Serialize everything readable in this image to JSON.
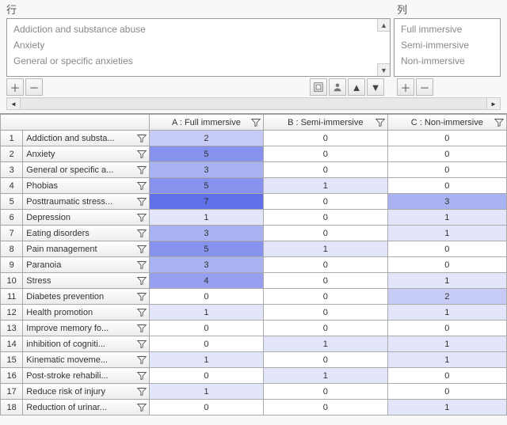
{
  "labels": {
    "rows_header": "行",
    "cols_header": "列"
  },
  "row_listbox": [
    "Addiction and substance abuse",
    "Anxiety",
    "General or specific anxieties"
  ],
  "col_listbox": [
    "Full immersive",
    "Semi-immersive",
    "Non-immersive"
  ],
  "columns": [
    {
      "key": "A",
      "label": "A : Full immersive"
    },
    {
      "key": "B",
      "label": "B : Semi-immersive"
    },
    {
      "key": "C",
      "label": "C : Non-immersive"
    }
  ],
  "rows": [
    {
      "n": 1,
      "label": "Addiction and substa...",
      "A": 2,
      "B": 0,
      "C": 0
    },
    {
      "n": 2,
      "label": "Anxiety",
      "A": 5,
      "B": 0,
      "C": 0
    },
    {
      "n": 3,
      "label": "General or specific a...",
      "A": 3,
      "B": 0,
      "C": 0
    },
    {
      "n": 4,
      "label": "Phobias",
      "A": 5,
      "B": 1,
      "C": 0
    },
    {
      "n": 5,
      "label": "Posttraumatic stress...",
      "A": 7,
      "B": 0,
      "C": 3
    },
    {
      "n": 6,
      "label": "Depression",
      "A": 1,
      "B": 0,
      "C": 1
    },
    {
      "n": 7,
      "label": "Eating disorders",
      "A": 3,
      "B": 0,
      "C": 1
    },
    {
      "n": 8,
      "label": "Pain management",
      "A": 5,
      "B": 1,
      "C": 0
    },
    {
      "n": 9,
      "label": "Paranoia",
      "A": 3,
      "B": 0,
      "C": 0
    },
    {
      "n": 10,
      "label": "Stress",
      "A": 4,
      "B": 0,
      "C": 1
    },
    {
      "n": 11,
      "label": "Diabetes prevention",
      "A": 0,
      "B": 0,
      "C": 2
    },
    {
      "n": 12,
      "label": "Health promotion",
      "A": 1,
      "B": 0,
      "C": 1
    },
    {
      "n": 13,
      "label": "Improve memory fo...",
      "A": 0,
      "B": 0,
      "C": 0
    },
    {
      "n": 14,
      "label": "inhibition of cogniti...",
      "A": 0,
      "B": 1,
      "C": 1
    },
    {
      "n": 15,
      "label": "Kinematic moveme...",
      "A": 1,
      "B": 0,
      "C": 1
    },
    {
      "n": 16,
      "label": "Post-stroke rehabili...",
      "A": 0,
      "B": 1,
      "C": 0
    },
    {
      "n": 17,
      "label": "Reduce risk of injury",
      "A": 1,
      "B": 0,
      "C": 0
    },
    {
      "n": 18,
      "label": "Reduction of urinar...",
      "A": 0,
      "B": 0,
      "C": 1
    }
  ],
  "chart_data": {
    "type": "heatmap",
    "title": "",
    "xlabel": "列",
    "ylabel": "行",
    "x_categories": [
      "Full immersive",
      "Semi-immersive",
      "Non-immersive"
    ],
    "y_categories": [
      "Addiction and substance abuse",
      "Anxiety",
      "General or specific anxieties",
      "Phobias",
      "Posttraumatic stress",
      "Depression",
      "Eating disorders",
      "Pain management",
      "Paranoia",
      "Stress",
      "Diabetes prevention",
      "Health promotion",
      "Improve memory",
      "inhibition of cognition",
      "Kinematic movement",
      "Post-stroke rehabilitation",
      "Reduce risk of injury",
      "Reduction of urinary"
    ],
    "values": [
      [
        2,
        0,
        0
      ],
      [
        5,
        0,
        0
      ],
      [
        3,
        0,
        0
      ],
      [
        5,
        1,
        0
      ],
      [
        7,
        0,
        3
      ],
      [
        1,
        0,
        1
      ],
      [
        3,
        0,
        1
      ],
      [
        5,
        1,
        0
      ],
      [
        3,
        0,
        0
      ],
      [
        4,
        0,
        1
      ],
      [
        0,
        0,
        2
      ],
      [
        1,
        0,
        1
      ],
      [
        0,
        0,
        0
      ],
      [
        0,
        1,
        1
      ],
      [
        1,
        0,
        1
      ],
      [
        0,
        1,
        0
      ],
      [
        1,
        0,
        0
      ],
      [
        0,
        0,
        1
      ]
    ],
    "value_range": [
      0,
      7
    ]
  }
}
